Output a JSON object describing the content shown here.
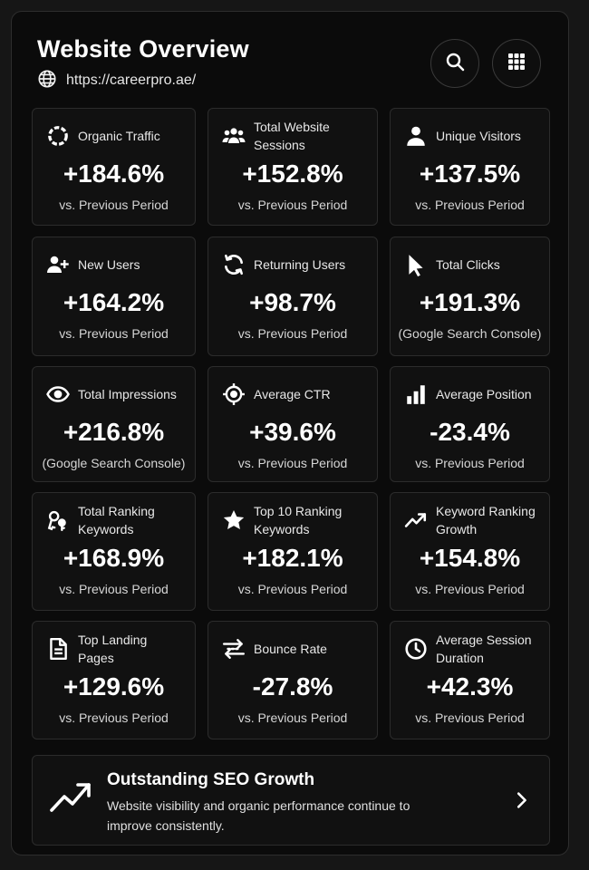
{
  "header": {
    "title": "Website Overview",
    "url": "https://careerpro.ae/"
  },
  "icons": {
    "header": [
      "globe-icon",
      "search-icon",
      "apps-grid-icon"
    ]
  },
  "cards": [
    {
      "label": "Organic Traffic",
      "value": "+184.6%",
      "sub": "vs. Previous Period",
      "icon": "ring-icon"
    },
    {
      "label": "Total Website Sessions",
      "value": "+152.8%",
      "sub": "vs. Previous Period",
      "icon": "users-group-icon"
    },
    {
      "label": "Unique Visitors",
      "value": "+137.5%",
      "sub": "vs. Previous Period",
      "icon": "user-icon"
    },
    {
      "label": "New Users",
      "value": "+164.2%",
      "sub": "vs. Previous Period",
      "icon": "user-plus-icon"
    },
    {
      "label": "Returning Users",
      "value": "+98.7%",
      "sub": "vs. Previous Period",
      "icon": "refresh-icon"
    },
    {
      "label": "Total Clicks",
      "value": "+191.3%",
      "sub": "(Google Search Console)",
      "icon": "cursor-icon"
    },
    {
      "label": "Total Impressions",
      "value": "+216.8%",
      "sub": "(Google Search Console)",
      "icon": "eye-icon"
    },
    {
      "label": "Average CTR",
      "value": "+39.6%",
      "sub": "vs. Previous Period",
      "icon": "target-icon"
    },
    {
      "label": "Average Position",
      "value": "-23.4%",
      "sub": "vs. Previous Period",
      "icon": "bar-chart-icon"
    },
    {
      "label": "Total Ranking Keywords",
      "value": "+168.9%",
      "sub": "vs. Previous Period",
      "icon": "keys-icon"
    },
    {
      "label": "Top 10 Ranking Keywords",
      "value": "+182.1%",
      "sub": "vs. Previous Period",
      "icon": "star-icon"
    },
    {
      "label": "Keyword Ranking Growth",
      "value": "+154.8%",
      "sub": "vs. Previous Period",
      "icon": "trending-up-icon"
    },
    {
      "label": "Top Landing Pages",
      "value": "+129.6%",
      "sub": "vs. Previous Period",
      "icon": "document-icon"
    },
    {
      "label": "Bounce Rate",
      "value": "-27.8%",
      "sub": "vs. Previous Period",
      "icon": "bounce-arrows-icon"
    },
    {
      "label": "Average Session Duration",
      "value": "+42.3%",
      "sub": "vs. Previous Period",
      "icon": "clock-icon"
    }
  ],
  "banner": {
    "title": "Outstanding SEO Growth",
    "text": "Website visibility and organic performance continue to improve consistently.",
    "icon": "trending-up-icon",
    "action_icon": "chevron-right-icon"
  },
  "colors": {
    "background": "#0b0b0b",
    "card": "#111111",
    "border": "#2c2c2c",
    "text": "#ffffff"
  }
}
